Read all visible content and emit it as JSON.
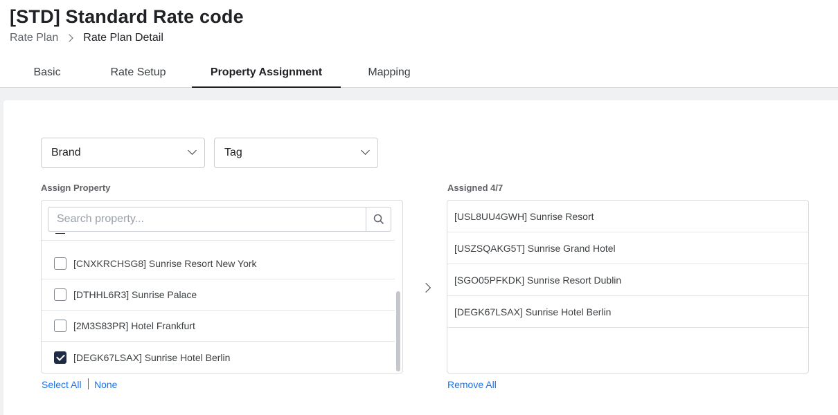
{
  "page": {
    "title": "[STD] Standard Rate code",
    "breadcrumb": {
      "parent": "Rate Plan",
      "current": "Rate Plan Detail"
    }
  },
  "tabs": [
    {
      "label": "Basic",
      "active": false
    },
    {
      "label": "Rate Setup",
      "active": false
    },
    {
      "label": "Property Assignment",
      "active": true
    },
    {
      "label": "Mapping",
      "active": false
    }
  ],
  "filters": {
    "brand": {
      "value": "Brand",
      "icon": "chevron-down-icon"
    },
    "tag": {
      "value": "Tag",
      "icon": "chevron-down-icon"
    }
  },
  "assign_property": {
    "label": "Assign Property",
    "search": {
      "placeholder": "Search property...",
      "value": "",
      "icon": "search-icon"
    },
    "items": [
      {
        "label": "[CNXKRCHSG8] Sunrise Resort New York",
        "checked": false
      },
      {
        "label": "[DTHHL6R3] Sunrise Palace",
        "checked": false
      },
      {
        "label": "[2M3S83PR] Hotel Frankfurt",
        "checked": false
      },
      {
        "label": "[DEGK67LSAX] Sunrise Hotel Berlin",
        "checked": true
      }
    ],
    "select_all": "Select All",
    "none": "None"
  },
  "assigned": {
    "label": "Assigned 4/7",
    "items": [
      "[USL8UU4GWH] Sunrise Resort",
      "[USZSQAKG5T] Sunrise Grand Hotel",
      "[SGO05PFKDK] Sunrise Resort Dublin",
      "[DEGK67LSAX] Sunrise Hotel Berlin"
    ],
    "remove_all": "Remove All"
  },
  "colors": {
    "accent": "#1a73e8",
    "checkbox_checked": "#1f2a44",
    "tab_underline": "#202124"
  }
}
